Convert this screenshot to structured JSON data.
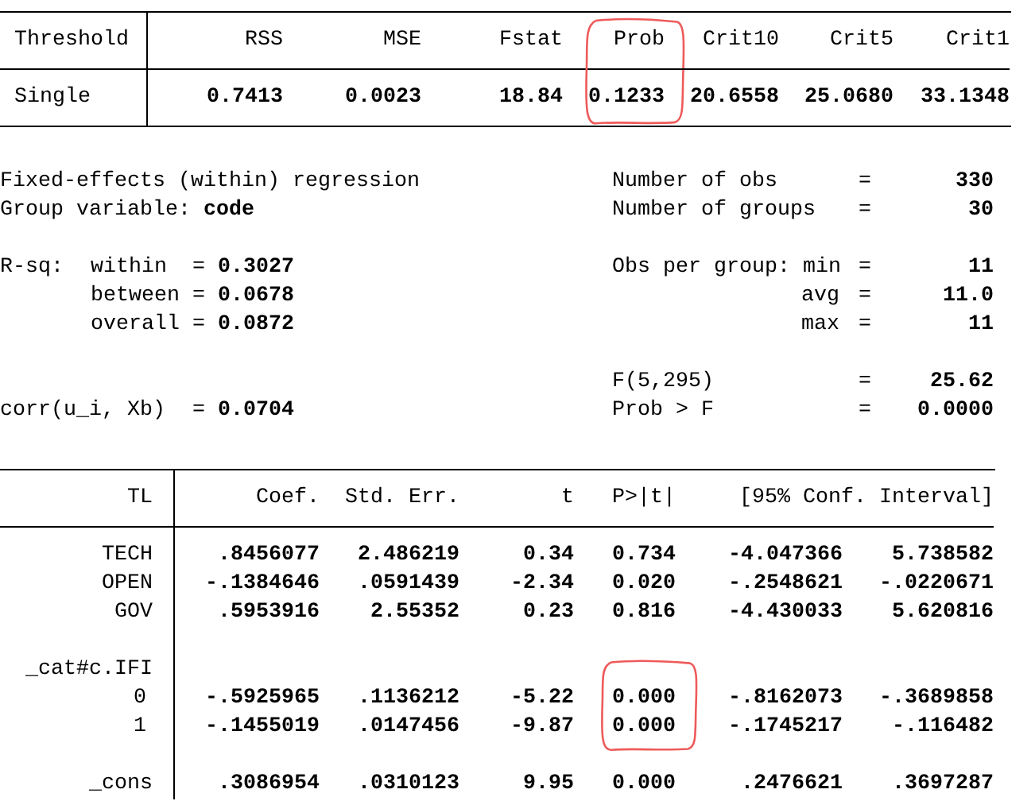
{
  "threshold_table": {
    "columns": [
      {
        "label": "Threshold",
        "circled": false
      },
      {
        "label": "RSS",
        "circled": false
      },
      {
        "label": "MSE",
        "circled": false
      },
      {
        "label": "Fstat",
        "circled": false
      },
      {
        "label": "Prob",
        "circled": true
      },
      {
        "label": "Crit10",
        "circled": false
      },
      {
        "label": "Crit5",
        "circled": false
      },
      {
        "label": "Crit1",
        "circled": false
      }
    ],
    "rows": [
      {
        "cells": [
          "Single",
          "0.7413",
          "0.0023",
          "18.84",
          "0.1233",
          "20.6558",
          "25.0680",
          "33.1348"
        ]
      }
    ]
  },
  "model_summary": {
    "blocks": [
      {
        "lines": [
          {
            "left": {
              "kind": "title",
              "text": "Fixed-effects (within) regression"
            },
            "right": {
              "kind": "main",
              "label": "Number of obs",
              "sign": "=",
              "value": "330"
            }
          },
          {
            "left": {
              "kind": "pair",
              "label": "Group variable:",
              "value": "code"
            },
            "right": {
              "kind": "main",
              "label": "Number of groups",
              "sign": "=",
              "value": "30"
            }
          }
        ]
      },
      {
        "lines": [
          {
            "left": {
              "kind": "rsq",
              "prefix": "R-sq:",
              "name": "within",
              "sign": "=",
              "value": "0.3027"
            },
            "right": {
              "kind": "main",
              "label": "Obs per group: min",
              "sign": "=",
              "value": "11"
            }
          },
          {
            "left": {
              "kind": "rsq",
              "name": "between",
              "sign": "=",
              "value": "0.0678"
            },
            "right": {
              "kind": "sub",
              "label": "avg",
              "sign": "=",
              "value": "11.0"
            }
          },
          {
            "left": {
              "kind": "rsq",
              "name": "overall",
              "sign": "=",
              "value": "0.0872"
            },
            "right": {
              "kind": "sub",
              "label": "max",
              "sign": "=",
              "value": "11"
            }
          }
        ]
      },
      {
        "lines": [
          {
            "right": {
              "kind": "main",
              "label": "F(5,295)",
              "sign": "=",
              "value": "25.62"
            }
          },
          {
            "left": {
              "kind": "stat",
              "label": "corr(u_i, Xb)",
              "sign": "=",
              "value": "0.0704"
            },
            "right": {
              "kind": "main",
              "label": "Prob > F",
              "sign": "=",
              "value": "0.0000"
            }
          }
        ]
      }
    ]
  },
  "regression_table": {
    "dependent_variable": "TL",
    "columns": [
      "Coef.",
      "Std. Err.",
      "t",
      "P>|t|",
      "[95% Conf. Interval]"
    ],
    "blocks": [
      {
        "rows": [
          {
            "kind": "var",
            "p_circled": false,
            "label": "TECH",
            "values": [
              ".8456077",
              "2.486219",
              "0.34",
              "0.734",
              "-4.047366",
              "5.738582"
            ]
          },
          {
            "kind": "var",
            "p_circled": false,
            "label": "OPEN",
            "values": [
              "-.1384646",
              ".0591439",
              "-2.34",
              "0.020",
              "-.2548621",
              "-.0220671"
            ]
          },
          {
            "kind": "var",
            "p_circled": false,
            "label": "GOV",
            "values": [
              ".5953916",
              "2.55352",
              "0.23",
              "0.816",
              "-4.430033",
              "5.620816"
            ]
          }
        ]
      },
      {
        "rows": [
          {
            "kind": "group",
            "p_circled": false,
            "label": "_cat#c.IFI"
          },
          {
            "kind": "level",
            "p_circled": true,
            "label": "0",
            "values": [
              "-.5925965",
              ".1136212",
              "-5.22",
              "0.000",
              "-.8162073",
              "-.3689858"
            ]
          },
          {
            "kind": "level",
            "p_circled": true,
            "label": "1",
            "values": [
              "-.1455019",
              ".0147456",
              "-9.87",
              "0.000",
              "-.1745217",
              "-.116482"
            ]
          }
        ]
      },
      {
        "rows": [
          {
            "kind": "var",
            "p_circled": false,
            "label": "_cons",
            "values": [
              ".3086954",
              ".0310123",
              "9.95",
              "0.000",
              ".2476621",
              ".3697287"
            ]
          }
        ]
      }
    ]
  }
}
